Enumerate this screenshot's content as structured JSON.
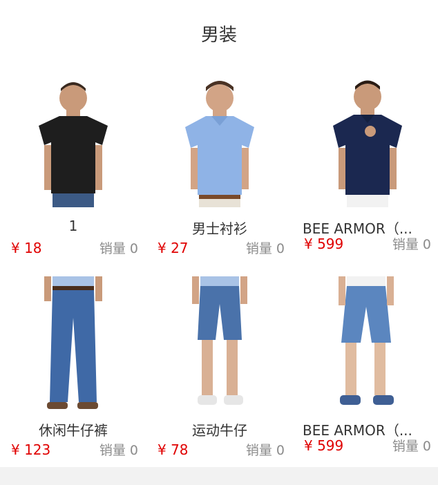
{
  "page": {
    "title": "男装"
  },
  "products": [
    {
      "name": "1",
      "price": "¥ 18",
      "sales": "销量 0",
      "image_icon": "black-tshirt-model-icon"
    },
    {
      "name": "男士衬衫",
      "price": "¥ 27",
      "sales": "销量 0",
      "image_icon": "blue-polo-model-icon"
    },
    {
      "name": "BEE ARMOR（...",
      "price": "¥ 599",
      "sales": "销量 0",
      "image_icon": "navy-polo-model-icon"
    },
    {
      "name": "休闲牛仔裤",
      "price": "¥ 123",
      "sales": "销量 0",
      "image_icon": "jeans-model-icon"
    },
    {
      "name": "运动牛仔",
      "price": "¥ 78",
      "sales": "销量 0",
      "image_icon": "denim-shorts-model-icon"
    },
    {
      "name": "BEE ARMOR（...",
      "price": "¥ 599",
      "sales": "销量 0",
      "image_icon": "denim-shorts-model-icon"
    }
  ],
  "colors": {
    "price": "#e00000",
    "muted": "#8c8c8c",
    "text": "#333333"
  }
}
